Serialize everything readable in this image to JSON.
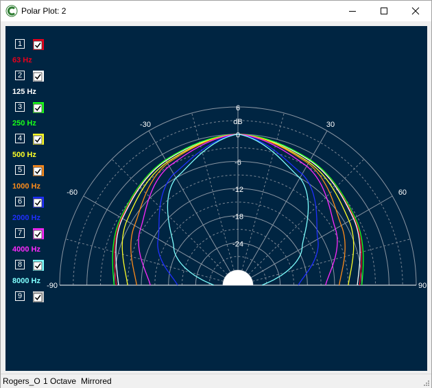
{
  "window": {
    "title": "Polar Plot: 2",
    "icon": "app-c-icon",
    "controls": [
      "minimize-icon",
      "maximize-icon",
      "close-icon"
    ]
  },
  "legend": [
    {
      "number": "1",
      "label": "63 Hz",
      "color": "#e8001c",
      "checked": true
    },
    {
      "number": "2",
      "label": "125 Hz",
      "color": "#ffffff",
      "checked": true
    },
    {
      "number": "3",
      "label": "250 Hz",
      "color": "#19ff19",
      "checked": true
    },
    {
      "number": "4",
      "label": "500 Hz",
      "color": "#ffff26",
      "checked": true
    },
    {
      "number": "5",
      "label": "1000 Hz",
      "color": "#ff8c1a",
      "checked": true
    },
    {
      "number": "6",
      "label": "2000 Hz",
      "color": "#1f2fff",
      "checked": true
    },
    {
      "number": "7",
      "label": "4000 Hz",
      "color": "#ff29ff",
      "checked": true
    },
    {
      "number": "8",
      "label": "8000 Hz",
      "color": "#7fffff",
      "checked": true
    },
    {
      "number": "9",
      "label": "",
      "color": "#c8c8c8",
      "checked": true
    }
  ],
  "chart_data": {
    "type": "polar",
    "unit_label": "dB",
    "radial_ticks": [
      "6",
      "0",
      "-6",
      "-12",
      "-18",
      "-24"
    ],
    "radial_range": [
      -30,
      6
    ],
    "angle_ticks": [
      -90,
      -60,
      -30,
      30,
      60,
      90
    ],
    "angle_range": [
      -90,
      90
    ],
    "mirrored": true,
    "series": [
      {
        "name": "63 Hz",
        "color": "#e8001c",
        "angles": [
          0,
          30,
          60,
          90
        ],
        "db": [
          0,
          -1.6,
          -3.7,
          -6.5
        ]
      },
      {
        "name": "125 Hz",
        "color": "#ffffff",
        "angles": [
          0,
          30,
          60,
          90
        ],
        "db": [
          0,
          -1.6,
          -3.9,
          -7
        ]
      },
      {
        "name": "250 Hz",
        "color": "#19ff19",
        "angles": [
          0,
          30,
          60,
          90
        ],
        "db": [
          0,
          -1.4,
          -3.5,
          -6
        ]
      },
      {
        "name": "500 Hz",
        "color": "#ffff26",
        "angles": [
          0,
          30,
          60,
          90
        ],
        "db": [
          0,
          -2,
          -5,
          -9
        ]
      },
      {
        "name": "1000 Hz",
        "color": "#ff8c1a",
        "angles": [
          0,
          30,
          60,
          90
        ],
        "db": [
          0,
          -2.3,
          -7,
          -11
        ]
      },
      {
        "name": "2000 Hz",
        "color": "#1f2fff",
        "angles": [
          0,
          30,
          60,
          90
        ],
        "db": [
          0,
          -5,
          -13,
          -20
        ]
      },
      {
        "name": "4000 Hz",
        "color": "#ff29ff",
        "angles": [
          0,
          30,
          60,
          90
        ],
        "db": [
          0,
          -3,
          -8.5,
          -14
        ]
      },
      {
        "name": "8000 Hz",
        "color": "#7fffff",
        "angles": [
          0,
          30,
          60,
          90
        ],
        "db": [
          0,
          -6,
          -17,
          -28
        ]
      }
    ]
  },
  "status": {
    "name": "Rogers_O",
    "bandwidth": "1 Octave",
    "mode": "Mirrored"
  }
}
